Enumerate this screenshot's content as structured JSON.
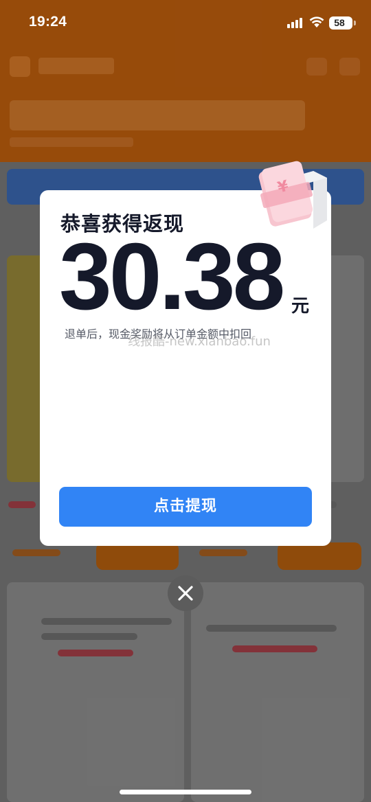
{
  "status_bar": {
    "time": "19:24",
    "battery": "58",
    "icons": [
      "signal-icon",
      "wifi-icon",
      "battery-icon"
    ]
  },
  "modal": {
    "title": "恭喜获得返现",
    "amount": "30.38",
    "unit": "元",
    "notice": "退单后，现金奖励将从订单金额中扣回",
    "watermark": "线报酷-new.xianbao.fun",
    "button_label": "点击提现",
    "gift_icon": "gift-box-icon"
  },
  "close_icon": "close-icon",
  "colors": {
    "button_blue": "#3184f5",
    "title_dark": "#15192a",
    "background_orange": "#c2600e",
    "gift_pink": "#f7c5cf"
  }
}
